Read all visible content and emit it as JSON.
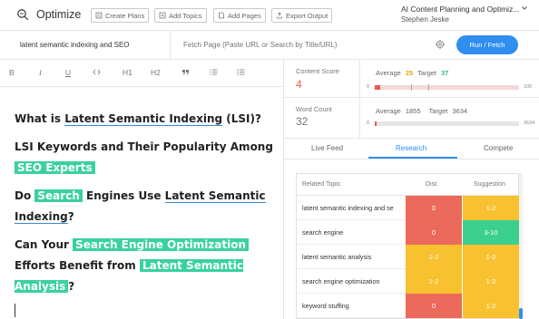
{
  "app": {
    "name": "Optimize"
  },
  "toolbar": {
    "create_plans": "Create Plans",
    "add_topics": "Add Topics",
    "add_pages": "Add Pages",
    "export_output": "Export Output"
  },
  "document": {
    "title": "AI Content Planning and Optimiz...",
    "owner": "Stephen Jeske"
  },
  "search": {
    "keyword": "latent semantic indexing and SEO",
    "fetch_placeholder": "Fetch Page (Paste URL or Search by Title/URL)",
    "run_label": "Run / Fetch"
  },
  "editor_tools": [
    "B",
    "I",
    "U",
    "H1",
    "H2"
  ],
  "editor": {
    "h1": {
      "a": "What is ",
      "b": "Latent Semantic Indexing",
      "c": " (LSI)?"
    },
    "h2": {
      "a": "LSI Keywords and Their Popularity Among ",
      "b": "SEO Experts"
    },
    "h3": {
      "a": "Do ",
      "b": "Search",
      "c": " Engines Use ",
      "d": "Latent Semantic Indexing",
      "e": "?"
    },
    "h4": {
      "a": "Can Your ",
      "b": "Search Engine Optimization",
      "c": " Efforts Benefit from ",
      "d": "Latent Semantic Analysis",
      "e": "?"
    }
  },
  "scores": {
    "content_score_label": "Content Score",
    "content_score": "4",
    "average_label": "Average",
    "content_average": "25",
    "target_label": "Target",
    "content_target": "37",
    "content_min": "0",
    "content_max": "100",
    "word_count_label": "Word Count",
    "word_count": "32",
    "word_average": "1855",
    "word_target": "3634",
    "word_min": "0",
    "word_max": "3634"
  },
  "bars": {
    "content_fill_fraction": 0.04,
    "content_average_fraction": 0.25,
    "content_target_fraction": 0.37,
    "word_fill_fraction": 0.009
  },
  "tabs": [
    "Live Feed",
    "Research",
    "Compete"
  ],
  "active_tab": "Research",
  "research": {
    "headers": {
      "topic": "Related Topic",
      "dist": "Dist.",
      "suggestion": "Suggestion"
    },
    "rows": [
      {
        "topic": "latent semantic indexing and se",
        "dist": "0",
        "suggestion": "1-2",
        "dist_color": "#ec6a5c",
        "sugg_color": "#f7c130"
      },
      {
        "topic": "search engine",
        "dist": "0",
        "suggestion": "3-10",
        "dist_color": "#ec6a5c",
        "sugg_color": "#3ccf8e"
      },
      {
        "topic": "latent semantic analysis",
        "dist": "1-2",
        "suggestion": "1-2",
        "dist_color": "#f7c130",
        "sugg_color": "#f7c130"
      },
      {
        "topic": "search engine optimization",
        "dist": "1-2",
        "suggestion": "1-2",
        "dist_color": "#f7c130",
        "sugg_color": "#f7c130"
      },
      {
        "topic": "keyword stuffing",
        "dist": "0",
        "suggestion": "1-2",
        "dist_color": "#ec6a5c",
        "sugg_color": "#f7c130"
      }
    ]
  },
  "colors": {
    "accent": "#2f8ef0",
    "highlight": "#3ad1a0",
    "link_underline": "#3a87d5",
    "score_red": "#e45f4b",
    "target_green": "#3bbf77",
    "average_orange": "#f2a516"
  }
}
